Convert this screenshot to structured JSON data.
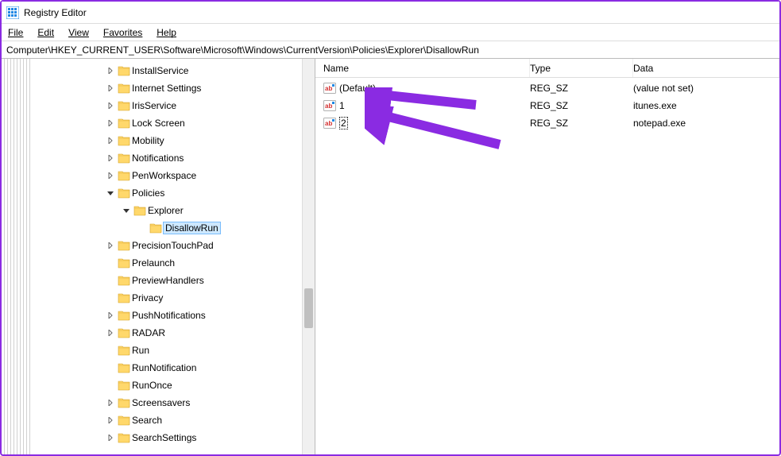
{
  "window": {
    "title": "Registry Editor"
  },
  "menu": {
    "file": "File",
    "edit": "Edit",
    "view": "View",
    "favorites": "Favorites",
    "help": "Help"
  },
  "address": "Computer\\HKEY_CURRENT_USER\\Software\\Microsoft\\Windows\\CurrentVersion\\Policies\\Explorer\\DisallowRun",
  "tree": [
    {
      "label": "InstallService",
      "indent": 130,
      "expander": "right"
    },
    {
      "label": "Internet Settings",
      "indent": 130,
      "expander": "right"
    },
    {
      "label": "IrisService",
      "indent": 130,
      "expander": "right"
    },
    {
      "label": "Lock Screen",
      "indent": 130,
      "expander": "right"
    },
    {
      "label": "Mobility",
      "indent": 130,
      "expander": "right"
    },
    {
      "label": "Notifications",
      "indent": 130,
      "expander": "right"
    },
    {
      "label": "PenWorkspace",
      "indent": 130,
      "expander": "right"
    },
    {
      "label": "Policies",
      "indent": 130,
      "expander": "down"
    },
    {
      "label": "Explorer",
      "indent": 150,
      "expander": "down"
    },
    {
      "label": "DisallowRun",
      "indent": 170,
      "expander": "none",
      "selected": true
    },
    {
      "label": "PrecisionTouchPad",
      "indent": 130,
      "expander": "right"
    },
    {
      "label": "Prelaunch",
      "indent": 130,
      "expander": "none"
    },
    {
      "label": "PreviewHandlers",
      "indent": 130,
      "expander": "none"
    },
    {
      "label": "Privacy",
      "indent": 130,
      "expander": "none"
    },
    {
      "label": "PushNotifications",
      "indent": 130,
      "expander": "right"
    },
    {
      "label": "RADAR",
      "indent": 130,
      "expander": "right"
    },
    {
      "label": "Run",
      "indent": 130,
      "expander": "none"
    },
    {
      "label": "RunNotification",
      "indent": 130,
      "expander": "none"
    },
    {
      "label": "RunOnce",
      "indent": 130,
      "expander": "none"
    },
    {
      "label": "Screensavers",
      "indent": 130,
      "expander": "right"
    },
    {
      "label": "Search",
      "indent": 130,
      "expander": "right"
    },
    {
      "label": "SearchSettings",
      "indent": 130,
      "expander": "right"
    }
  ],
  "list": {
    "headers": {
      "name": "Name",
      "type": "Type",
      "data": "Data"
    },
    "rows": [
      {
        "name": "(Default)",
        "type": "REG_SZ",
        "data": "(value not set)",
        "editing": false
      },
      {
        "name": "1",
        "type": "REG_SZ",
        "data": "itunes.exe",
        "editing": false
      },
      {
        "name": "2",
        "type": "REG_SZ",
        "data": "notepad.exe",
        "editing": true
      }
    ]
  }
}
